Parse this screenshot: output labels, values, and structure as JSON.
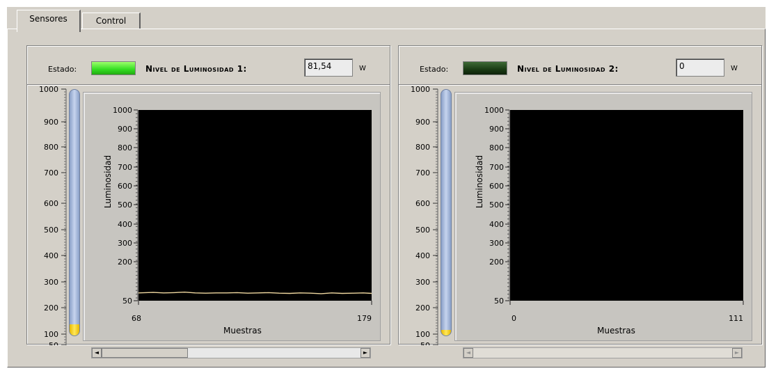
{
  "tabs": [
    {
      "label": "Sensores"
    },
    {
      "label": "Control"
    }
  ],
  "panels": [
    {
      "estado_label": "Estado:",
      "led": "on",
      "nivel_label": "Nivel de Luminosidad 1:",
      "value": "81,54",
      "unit": "W",
      "thermo_ticks": [
        "1000",
        "900",
        "800",
        "700",
        "600",
        "500",
        "400",
        "300",
        "200",
        "100",
        "50"
      ],
      "thermo_level": 81.54,
      "chart": {
        "ylabel": "Luminosidad",
        "xlabel": "Muestras",
        "y_ticks": [
          "1000",
          "900",
          "800",
          "700",
          "600",
          "500",
          "400",
          "300",
          "200",
          "50"
        ],
        "x_ticks": [
          "68",
          "179"
        ]
      }
    },
    {
      "estado_label": "Estado:",
      "led": "off",
      "nivel_label": "Nivel de Luminosidad 2:",
      "value": "0",
      "unit": "W",
      "thermo_ticks": [
        "1000",
        "900",
        "800",
        "700",
        "600",
        "500",
        "400",
        "300",
        "200",
        "100",
        "50"
      ],
      "thermo_level": 0,
      "chart": {
        "ylabel": "Luminosidad",
        "xlabel": "Muestras",
        "y_ticks": [
          "1000",
          "900",
          "800",
          "700",
          "600",
          "500",
          "400",
          "300",
          "200",
          "50"
        ],
        "x_ticks": [
          "0",
          "111"
        ]
      }
    }
  ],
  "chart_data": [
    {
      "type": "line",
      "xlabel": "Muestras",
      "ylabel": "Luminosidad",
      "xlim": [
        68,
        179
      ],
      "ylim": [
        50,
        1000
      ],
      "series": [
        {
          "color": "#f0d8a0",
          "x": [
            68,
            75,
            80,
            85,
            90,
            95,
            100,
            105,
            110,
            115,
            120,
            125,
            130,
            135,
            140,
            145,
            150,
            155,
            160,
            165,
            170,
            175,
            179
          ],
          "y": [
            80,
            82,
            80,
            81,
            83,
            80,
            79,
            80,
            80,
            81,
            79,
            80,
            81,
            79,
            78,
            80,
            79,
            77,
            80,
            78,
            79,
            80,
            78
          ]
        }
      ]
    },
    {
      "type": "line",
      "xlabel": "Muestras",
      "ylabel": "Luminosidad",
      "xlim": [
        0,
        111
      ],
      "ylim": [
        50,
        1000
      ],
      "series": []
    }
  ]
}
